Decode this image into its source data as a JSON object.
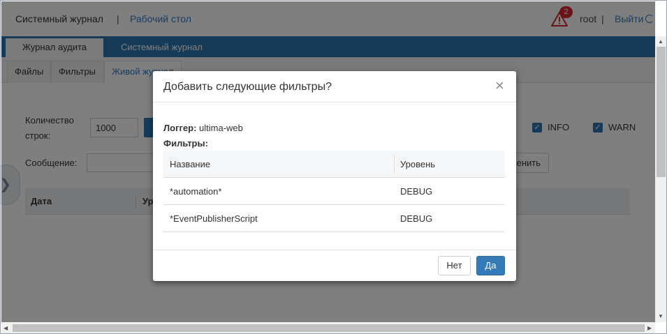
{
  "header": {
    "app_title": "Системный журнал",
    "separator": "|",
    "desktop_link": "Рабочий стол",
    "alert_count": "2",
    "user": "root",
    "logout": "Выйти"
  },
  "tabs": {
    "audit": "Журнал аудита",
    "system": "Системный журнал"
  },
  "subtabs": {
    "files": "Файлы",
    "filters": "Фильтры",
    "live": "Живой журнал"
  },
  "form": {
    "lines_label_1": "Количество",
    "lines_label_2": "строк:",
    "lines_value": "1000",
    "message_label": "Сообщение:",
    "info_label": "INFO",
    "warn_label": "WARN",
    "apply_partial": "енить",
    "check_mark": "✓"
  },
  "grid": {
    "col_date": "Дата",
    "col_level_partial": "Ур"
  },
  "modal": {
    "title": "Добавить следующие фильтры?",
    "close": "×",
    "logger_label": "Логгер:",
    "logger_value": "ultima-web",
    "filters_label": "Фильтры:",
    "columns": [
      "Название",
      "Уровень"
    ],
    "rows": [
      {
        "name": "*automation*",
        "level": "DEBUG"
      },
      {
        "name": "*EventPublisherScript",
        "level": "DEBUG"
      }
    ],
    "no_button": "Нет",
    "yes_button": "Да"
  },
  "side_toggle": "❯",
  "colors": {
    "accent": "#2d77b1",
    "link": "#2e7bbf",
    "alert": "#d9262a"
  }
}
